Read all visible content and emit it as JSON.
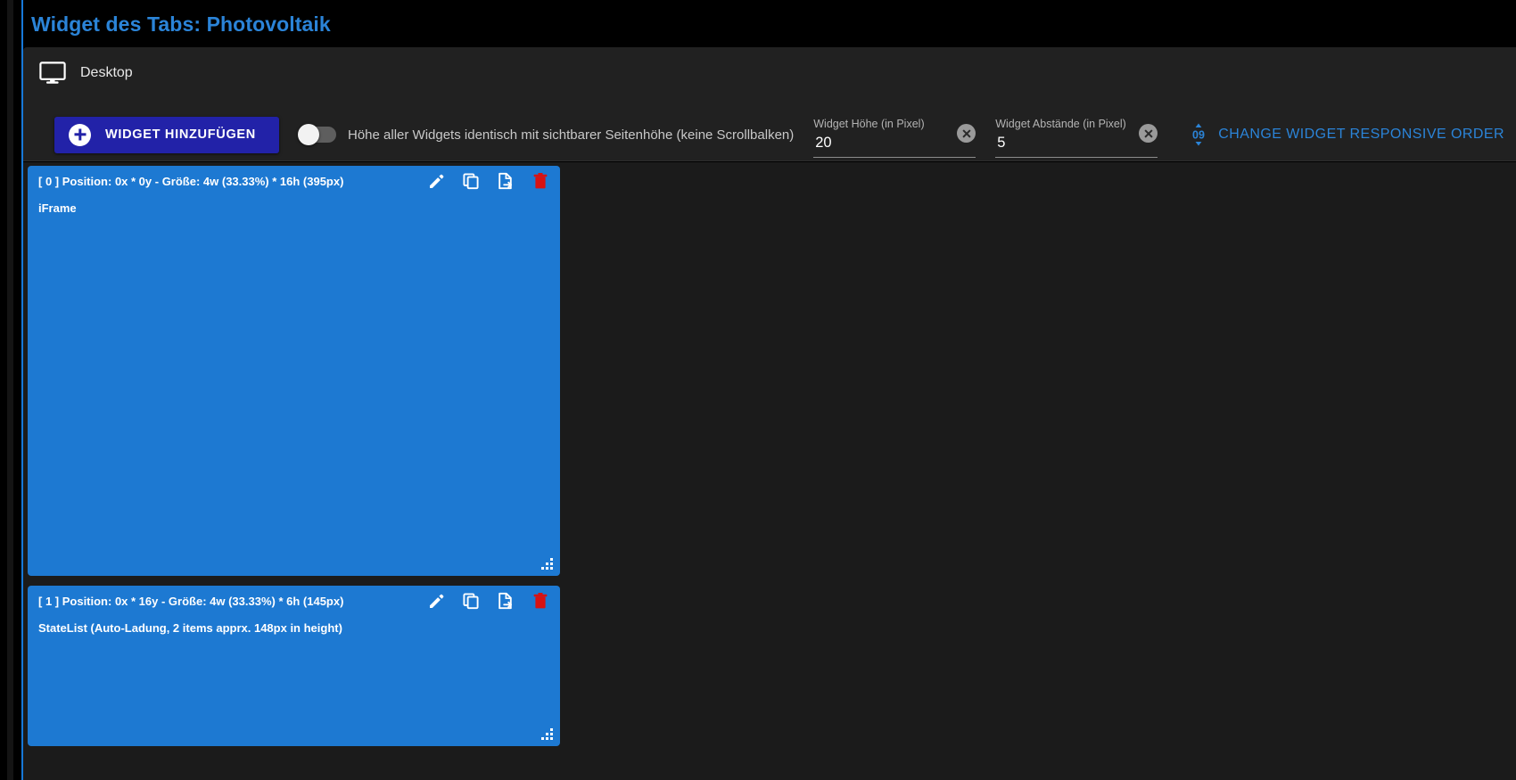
{
  "page": {
    "title": "Widget des Tabs: Photovoltaik",
    "accent_blue": "#2b84d8",
    "widget_blue": "#1d79d2",
    "panel_bg": "#212121",
    "canvas_bg": "#1b1b1b",
    "page_bg": "#000000"
  },
  "device": {
    "icon": "monitor-icon",
    "label": "Desktop"
  },
  "toolbar": {
    "add_widget_label": "WIDGET HINZUFÜGEN",
    "add_widget_icon": "plus-circle-icon",
    "toggle": {
      "label": "Höhe aller Widgets identisch mit sichtbarer Seitenhöhe (keine Scrollbalken)",
      "state": "off"
    },
    "fields": [
      {
        "label": "Widget Höhe (in Pixel)",
        "value": "20",
        "placeholder": "",
        "clear_icon": "clear-circle-icon"
      },
      {
        "label": "Widget Abstände (in Pixel)",
        "value": "5",
        "placeholder": "",
        "clear_icon": "clear-circle-icon"
      }
    ],
    "order_link": {
      "icon": "sort-numeric-09-icon",
      "label": "CHANGE WIDGET RESPONSIVE ORDER"
    }
  },
  "widgets": [
    {
      "index_label": "[ 0 ]",
      "title": "[ 0 ]  Position: 0x * 0y - Größe: 4w (33.33%) * 16h (395px)",
      "body": "iFrame",
      "actions": [
        "edit-pencil-icon",
        "duplicate-icon",
        "export-file-icon",
        "delete-trash-icon"
      ],
      "resize_handle": "resize-grip-icon"
    },
    {
      "index_label": "[ 1 ]",
      "title": "[ 1 ]  Position: 0x * 16y - Größe: 4w (33.33%) * 6h (145px)",
      "body": "StateList (Auto-Ladung, 2 items apprx. 148px in height)",
      "actions": [
        "edit-pencil-icon",
        "duplicate-icon",
        "export-file-icon",
        "delete-trash-icon"
      ],
      "resize_handle": "resize-grip-icon"
    }
  ]
}
